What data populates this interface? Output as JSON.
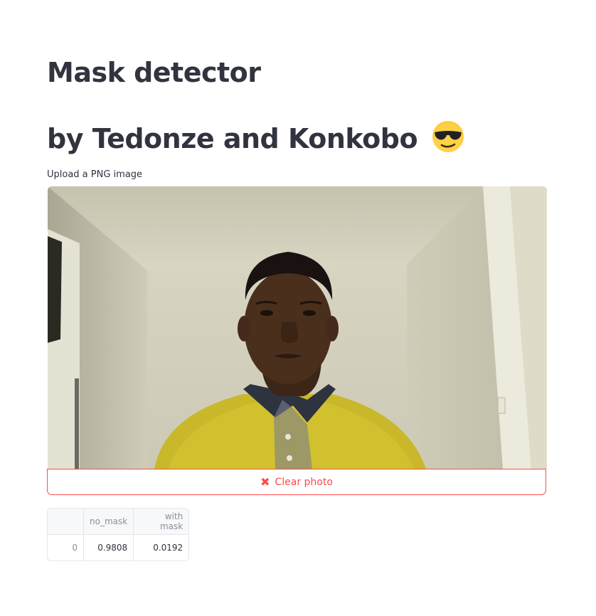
{
  "header": {
    "title": "Mask detector",
    "subtitle": "by Tedonze and Konkobo",
    "subtitle_emoji_icon": "smiling-face-with-sunglasses-icon"
  },
  "uploader": {
    "label": "Upload a PNG image",
    "clear_button_label": "Clear photo",
    "clear_icon": "close-icon",
    "accent_color": "#ff4b4b"
  },
  "results_table": {
    "columns": [
      "",
      "no_mask",
      "with mask"
    ],
    "rows": [
      {
        "index": "0",
        "no_mask": "0.9808",
        "with_mask": "0.0192"
      }
    ]
  }
}
